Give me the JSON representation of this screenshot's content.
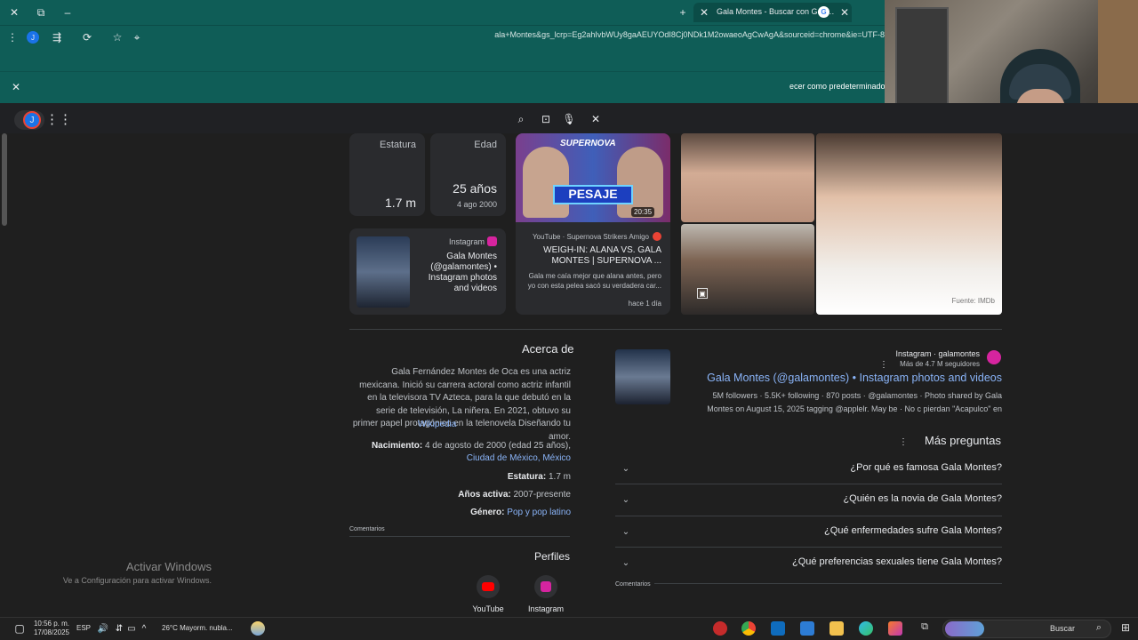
{
  "browser": {
    "tab_title": "Gala Montes - Buscar con Goo…",
    "url": "ala+Montes&gs_lcrp=Eg2ahIvbWUy8gaAEUYOdI8Cj0NDk1M2owaeoAgCwAgA&sourceid=chrome&ie=UTF-8",
    "infobar_text": "ecer como predeterminado"
  },
  "colors": {
    "chrome": "#0f5d57",
    "page": "#1f1f1f",
    "link": "#8ab4f8",
    "accent_red": "#ea4335"
  },
  "google": {
    "avatar_letter": "J"
  },
  "knowledge": {
    "stats": [
      {
        "label": "Estatura",
        "value": "1.7 m",
        "sub": ""
      },
      {
        "label": "Edad",
        "value": "25 años",
        "sub": "4 ago 2000"
      }
    ],
    "instagram_card": {
      "source": "Instagram",
      "text": "Gala Montes (@galamontes) • Instagram photos and videos"
    },
    "youtube_card": {
      "thumb_badge": "20:35",
      "thumb_text": "PESAJE",
      "thumb_brand": "SUPERNOVA",
      "channel": "YouTube · Supernova Strikers Amigo",
      "title": "WEIGH-IN: ALANA VS. GALA MONTES | SUPERNOVA ...",
      "snippet": "Gala me caía mejor que alana antes, pero yo con esta pelea sacó su verdadera car...",
      "age": "hace 1 día"
    },
    "image_source": "Fuente: IMDb"
  },
  "about": {
    "heading": "Acerca de",
    "description": "Gala Fernández Montes de Oca es una actriz mexicana. Inició su carrera actoral como actriz infantil en la televisora TV Azteca, para la que debutó en la serie de televisión, La niñera. En 2021, obtuvo su primer papel protagónico en la telenovela Diseñando tu amor.",
    "wiki_link": "Wikipedia",
    "facts": [
      {
        "label": "Nacimiento:",
        "value": "4 de agosto de 2000 (edad 25 años),",
        "link": "Ciudad de México, México"
      },
      {
        "label": "Estatura:",
        "value": "1.7 m",
        "link": ""
      },
      {
        "label": "Años activa:",
        "value": "2007-presente",
        "link": ""
      },
      {
        "label": "Género:",
        "value": "",
        "link": "Pop y pop latino"
      }
    ],
    "feedback": "Comentarios",
    "profiles_heading": "Perfiles",
    "profiles": [
      {
        "name": "Instagram",
        "color": "#d6249f"
      },
      {
        "name": "YouTube",
        "color": "#ff0000"
      }
    ]
  },
  "result": {
    "site": "Instagram · galamontes",
    "followers": "Más de 4.7 M seguidores",
    "title": "Gala Montes (@galamontes) • Instagram photos and videos",
    "snippet_a": "5M followers · 5.5K+ following · 870 posts · @galamontes · Photo shared by Gala",
    "snippet_b": "Montes on August 15, 2025 tagging @applelr. May be · No c pierdan \"Acapulco\" en"
  },
  "paa": {
    "heading": "Más preguntas",
    "questions": [
      "¿Por qué es famosa Gala Montes?",
      "¿Quién es la novia de Gala Montes?",
      "¿Qué enfermedades sufre Gala Montes?",
      "¿Qué preferencias sexuales tiene Gala Montes?"
    ],
    "feedback": "Comentarios"
  },
  "windows": {
    "activate_title": "Activar Windows",
    "activate_sub": "Ve a Configuración para activar Windows.",
    "time": "10:56 p. m.",
    "date": "17/08/2025",
    "lang": "ESP",
    "weather": "26°C Mayorm. nubla...",
    "search": "Buscar"
  }
}
